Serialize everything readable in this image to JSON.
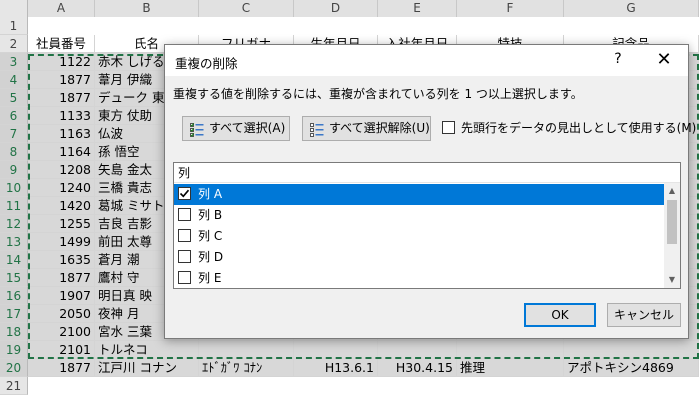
{
  "sheet": {
    "columns": [
      "A",
      "B",
      "C",
      "D",
      "E",
      "F",
      "G"
    ],
    "row_numbers": [
      "1",
      "2",
      "3",
      "4",
      "5",
      "6",
      "7",
      "8",
      "9",
      "10",
      "11",
      "12",
      "13",
      "14",
      "15",
      "16",
      "17",
      "18",
      "19",
      "20",
      "21"
    ],
    "header_row": [
      "社員番号",
      "氏名",
      "フリガナ",
      "生年月日",
      "入社年月日",
      "特技",
      "記念品"
    ],
    "rows": [
      [
        "1122",
        "赤木 しげる"
      ],
      [
        "1877",
        "葦月 伊織"
      ],
      [
        "1877",
        "デューク 東"
      ],
      [
        "1133",
        "東方 仗助"
      ],
      [
        "1163",
        "仏波"
      ],
      [
        "1164",
        "孫 悟空"
      ],
      [
        "1208",
        "矢島 金太"
      ],
      [
        "1240",
        "三橋 貴志"
      ],
      [
        "1420",
        "葛城 ミサト"
      ],
      [
        "1255",
        "吉良 吉影"
      ],
      [
        "1499",
        "前田 太尊"
      ],
      [
        "1635",
        "蒼月 潮"
      ],
      [
        "1877",
        "鷹村 守"
      ],
      [
        "1907",
        "明日真 映"
      ],
      [
        "2050",
        "夜神 月"
      ],
      [
        "2100",
        "宮水 三葉"
      ],
      [
        "2101",
        "トルネコ"
      ]
    ],
    "last_row": [
      "1877",
      "江戸川 コナン",
      "ｴﾄﾞｶﾞﾜ ｺﾅﾝ",
      "H13.6.1",
      "H30.4.15",
      "推理",
      "アポトキシン4869"
    ]
  },
  "dialog": {
    "title": "重複の削除",
    "help": "?",
    "close": "✕",
    "description": "重複する値を削除するには、重複が含まれている列を 1 つ以上選択します。",
    "select_all": "すべて選択(A)",
    "unselect_all": "すべて選択解除(U)",
    "header_checkbox_label": "先頭行をデータの見出しとして使用する(M)",
    "header_checkbox_checked": false,
    "list_header": "列",
    "items": [
      {
        "label": "列 A",
        "checked": true,
        "selected": true
      },
      {
        "label": "列 B",
        "checked": false,
        "selected": false
      },
      {
        "label": "列 C",
        "checked": false,
        "selected": false
      },
      {
        "label": "列 D",
        "checked": false,
        "selected": false
      },
      {
        "label": "列 E",
        "checked": false,
        "selected": false
      }
    ],
    "ok": "OK",
    "cancel": "キャンセル"
  },
  "colors": {
    "selection_blue": "#0078d7",
    "excel_green": "#217346"
  },
  "icons": [
    "checklist-icon",
    "unchecklist-icon",
    "check-icon",
    "scroll-up-icon",
    "scroll-down-icon",
    "close-icon",
    "help-icon"
  ]
}
